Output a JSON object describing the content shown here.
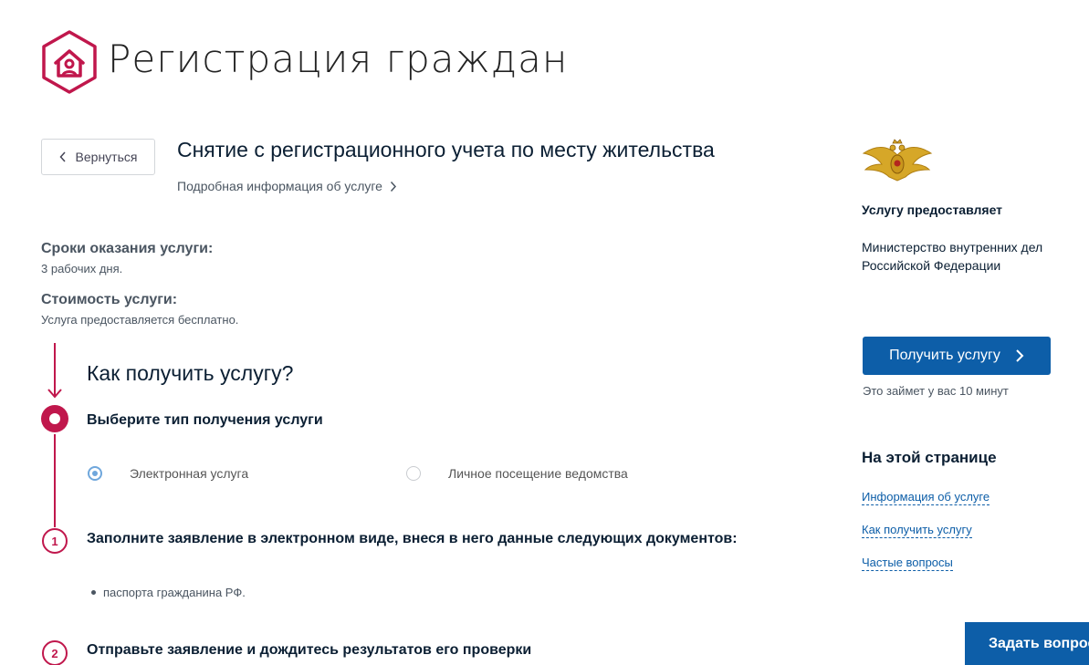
{
  "header": {
    "title": "Регистрация граждан"
  },
  "back_button": {
    "label": "Вернуться"
  },
  "service": {
    "title": "Снятие с регистрационного учета по месту жительства",
    "details_link": "Подробная информация об услуге"
  },
  "info": {
    "term_label": "Сроки оказания услуги:",
    "term_value": "3 рабочих дня.",
    "cost_label": "Стоимость услуги:",
    "cost_value": "Услуга предоставляется бесплатно."
  },
  "how": {
    "title": "Как получить услугу?",
    "step0": {
      "title": "Выберите тип получения услуги",
      "options": [
        {
          "label": "Электронная услуга",
          "selected": true
        },
        {
          "label": "Личное посещение ведомства",
          "selected": false
        }
      ]
    },
    "step1": {
      "number": "1",
      "title": "Заполните заявление в электронном виде, внеся в него данные следующих документов:",
      "items": [
        "паспорта гражданина РФ."
      ]
    },
    "step2": {
      "number": "2",
      "title": "Отправьте заявление и дождитесь результатов его проверки"
    }
  },
  "sidebar": {
    "provider_label": "Услугу предоставляет",
    "provider_name": "Министерство внутренних дел Российской Федерации",
    "get_service_button": "Получить услугу",
    "time_note": "Это займет у вас 10 минут",
    "on_page_title": "На этой странице",
    "nav_links": [
      "Информация об услуге",
      "Как получить услугу",
      "Частые вопросы"
    ]
  },
  "ask_button": {
    "label": "Задать вопрос"
  },
  "colors": {
    "accent": "#c0174c",
    "primary_button": "#0d5ea8",
    "radio": "#6fa7dc"
  },
  "icons": [
    "house-person-logo-icon",
    "chevron-left-icon",
    "chevron-right-icon",
    "emblem-icon",
    "headset-icon"
  ]
}
